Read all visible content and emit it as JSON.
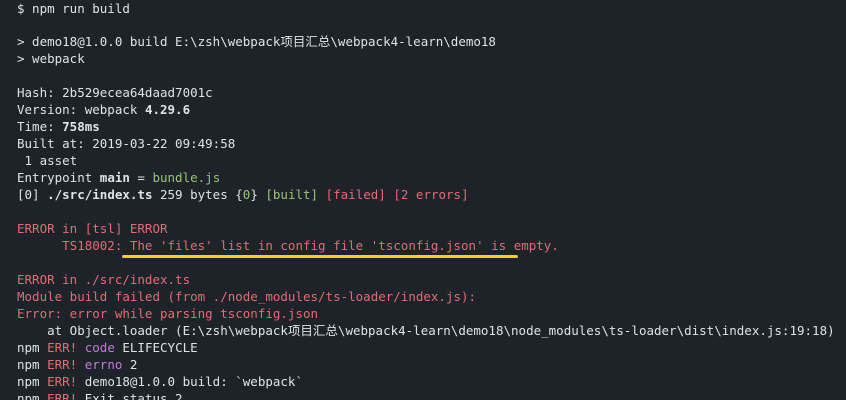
{
  "terminal": {
    "prompt_line": "$ npm run build",
    "script_line1": "> demo18@1.0.0 build E:\\zsh\\webpack项目汇总\\webpack4-learn\\demo18",
    "script_line2": "> webpack",
    "hash": "Hash: 2b529ecea64daad7001c",
    "version_label": "Version: webpack ",
    "version_value": "4.29.6",
    "time_label": "Time: ",
    "time_value": "758ms",
    "built_at": "Built at: 2019-03-22 09:49:58",
    "asset_count": " 1 asset",
    "entrypoint_label": "Entrypoint ",
    "entrypoint_name": "main",
    "entrypoint_eq": " = ",
    "entrypoint_file": "bundle.js",
    "module_index": "[0] ",
    "module_path": "./src/index.ts",
    "module_size": " 259 bytes {",
    "module_chunk": "0",
    "module_close": "} ",
    "module_built": "[built]",
    "module_failed": "[failed]",
    "module_errors": "[2 errors]",
    "error1_line1": "ERROR in [tsl] ERROR",
    "error1_line2": "      TS18002: The 'files' list in config file 'tsconfig.json' is empty.",
    "error2_line1": "ERROR in ./src/index.ts",
    "error2_line2": "Module build failed (from ./node_modules/ts-loader/index.js):",
    "error2_line3": "Error: error while parsing tsconfig.json",
    "error2_line4": "    at Object.loader (E:\\zsh\\webpack项目汇总\\webpack4-learn\\demo18\\node_modules\\ts-loader\\dist\\index.js:19:18)",
    "npm_err_prefix": "npm ",
    "npm_err_tag": "ERR!",
    "npm_err1_key": "code",
    "npm_err1_val": " ELIFECYCLE",
    "npm_err2_key": "errno",
    "npm_err2_val": " 2",
    "npm_err3_text": " demo18@1.0.0 build: `webpack`",
    "npm_err4_text": " Exit status 2"
  },
  "colors": {
    "background": "#1e2329",
    "text": "#dfe3e7",
    "green": "#98c379",
    "red": "#e06c75",
    "purple": "#c678dd",
    "highlight_underline": "#f2d600"
  }
}
